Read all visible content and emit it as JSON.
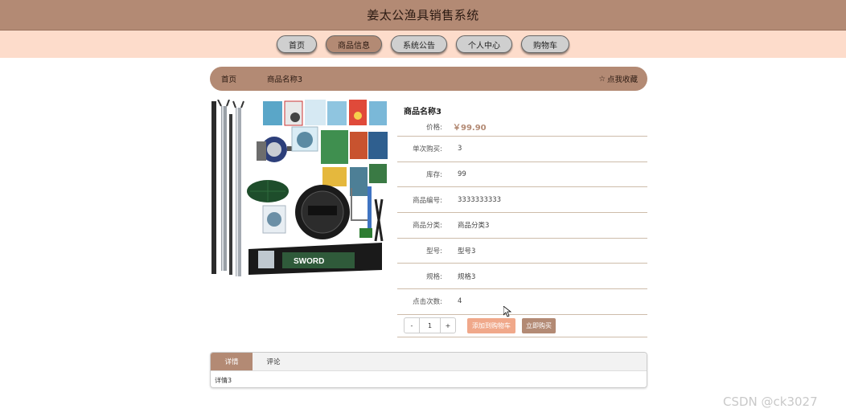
{
  "header": {
    "title": "姜太公渔具销售系统"
  },
  "nav": {
    "items": [
      {
        "label": "首页",
        "active": false
      },
      {
        "label": "商品信息",
        "active": true
      },
      {
        "label": "系统公告",
        "active": false
      },
      {
        "label": "个人中心",
        "active": false
      },
      {
        "label": "购物车",
        "active": false
      }
    ]
  },
  "breadcrumb": {
    "home": "首页",
    "current": "商品名称3",
    "favorite": "点我收藏"
  },
  "product": {
    "name": "商品名称3",
    "price_label": "价格:",
    "price": "￥99.90",
    "details": [
      {
        "label": "单次购买:",
        "value": "3"
      },
      {
        "label": "库存:",
        "value": "99"
      },
      {
        "label": "商品编号:",
        "value": "3333333333"
      },
      {
        "label": "商品分类:",
        "value": "商品分类3"
      },
      {
        "label": "型号:",
        "value": "型号3"
      },
      {
        "label": "规格:",
        "value": "规格3"
      },
      {
        "label": "点击次数:",
        "value": "4"
      }
    ],
    "image_text": "SWORD"
  },
  "actions": {
    "minus": "-",
    "quantity": "1",
    "plus": "+",
    "add_cart": "添加到购物车",
    "buy_now": "立即购买"
  },
  "tabs": {
    "items": [
      {
        "label": "详情",
        "active": true
      },
      {
        "label": "评论",
        "active": false
      }
    ],
    "content": "详情3"
  },
  "watermark": "CSDN @ck3027",
  "colors": {
    "brand": "#b38a74",
    "nav_bg": "#fddccb",
    "cart_btn": "#f0a88a"
  }
}
